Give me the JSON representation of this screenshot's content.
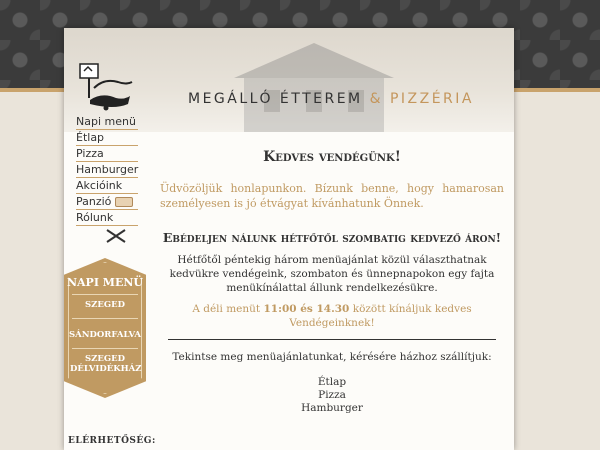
{
  "header": {
    "title_main": "MEGÁLLÓ ÉTTEREM",
    "title_amp": " & PIZZÉRIA",
    "logo_text": "MEGÁLLÓ ÉTTEREM"
  },
  "nav": {
    "items": [
      {
        "label": "Napi menü"
      },
      {
        "label": "Étlap"
      },
      {
        "label": "Pizza"
      },
      {
        "label": "Hamburger"
      },
      {
        "label": "Akcióink"
      },
      {
        "label": "Panzió"
      },
      {
        "label": "Rólunk"
      }
    ]
  },
  "daily_menu": {
    "title": "NAPI MENÜ",
    "locations": [
      {
        "label": "SZEGED"
      },
      {
        "label": "SÁNDORFALVA"
      },
      {
        "label": "SZEGED DÉLVIDÉKHÁZ"
      }
    ]
  },
  "sidebar": {
    "contact_heading": "ELÉRHETŐSÉG:"
  },
  "content": {
    "welcome_title": "Kedves vendégünk!",
    "welcome_text": "Üdvözöljük honlapunkon. Bízunk benne, hogy hamarosan személyesen is jó étvágyat kívánhatunk Önnek.",
    "lunch_title": "Ebédeljen nálunk hétfőtől szombatig kedvező áron!",
    "lunch_desc": "Hétfőtől péntekig három menüajánlat közül választhatnak kedvükre vendégeink, szombaton és ünnepnapokon egy fajta menükínálattal állunk rendelkezésükre.",
    "lunch_time_prefix": "A déli menüt ",
    "lunch_time_value": "11:00 és 14.30",
    "lunch_time_suffix": " között kínáljuk kedves Vendégeinknek!",
    "offer_text": "Tekintse meg menüajánlatunkat, kérésére házhoz szállítjuk:",
    "menu_links": [
      {
        "label": "Étlap"
      },
      {
        "label": "Pizza"
      },
      {
        "label": "Hamburger"
      }
    ]
  },
  "colors": {
    "accent": "#c09a62",
    "dark": "#333333"
  }
}
